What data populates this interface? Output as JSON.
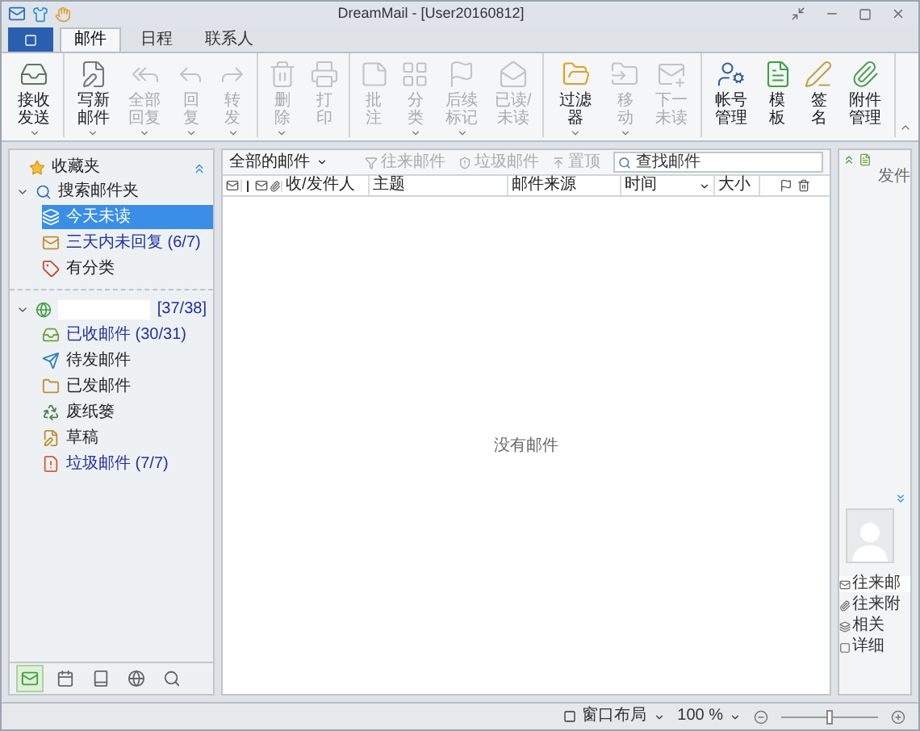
{
  "window": {
    "title": "DreamMail - [User20160812]"
  },
  "tabs": [
    {
      "label": "邮件",
      "selected": true
    },
    {
      "label": "日程",
      "selected": false
    },
    {
      "label": "联系人",
      "selected": false
    }
  ],
  "ribbon": [
    [
      {
        "label": "接收发送",
        "disabled": false,
        "dropdown": true
      }
    ],
    [
      {
        "label": "写新邮件",
        "disabled": false,
        "dropdown": true
      },
      {
        "label": "全部回复",
        "disabled": true,
        "dropdown": true
      },
      {
        "label": "回复",
        "disabled": true,
        "dropdown": true
      },
      {
        "label": "转发",
        "disabled": true,
        "dropdown": true
      }
    ],
    [
      {
        "label": "删除",
        "disabled": true,
        "dropdown": true
      },
      {
        "label": "打印",
        "disabled": true,
        "dropdown": false
      }
    ],
    [
      {
        "label": "批注",
        "disabled": true,
        "dropdown": false
      },
      {
        "label": "分类",
        "disabled": true,
        "dropdown": true
      },
      {
        "label": "后续标记",
        "disabled": true,
        "dropdown": true
      },
      {
        "label": "已读/未读",
        "disabled": true,
        "dropdown": false
      }
    ],
    [
      {
        "label": "过滤器",
        "disabled": false,
        "dropdown": true
      },
      {
        "label": "移动",
        "disabled": true,
        "dropdown": true
      },
      {
        "label": "下一未读",
        "disabled": true,
        "dropdown": false
      }
    ],
    [
      {
        "label": "帐号管理",
        "disabled": false,
        "dropdown": false
      },
      {
        "label": "模板",
        "disabled": false,
        "dropdown": false
      },
      {
        "label": "签名",
        "disabled": false,
        "dropdown": false
      },
      {
        "label": "附件管理",
        "disabled": false,
        "dropdown": false
      }
    ]
  ],
  "sidebar": {
    "favorites": {
      "label": "收藏夹",
      "expanded": true,
      "children": [
        {
          "label": "搜索邮件夹",
          "expanded": true,
          "children": [
            {
              "label": "今天未读",
              "selected": true,
              "unread": false
            },
            {
              "label": "三天内未回复 (6/7)",
              "selected": false,
              "unread": true
            },
            {
              "label": "有分类",
              "selected": false,
              "unread": false
            }
          ]
        }
      ]
    },
    "account": {
      "count": "[37/38]",
      "expanded": true,
      "children": [
        {
          "label": "已收邮件 (30/31)",
          "selected": false,
          "unread": true
        },
        {
          "label": "待发邮件",
          "selected": false,
          "unread": false
        },
        {
          "label": "已发邮件",
          "selected": false,
          "unread": false
        },
        {
          "label": "废纸篓",
          "selected": false,
          "unread": false
        },
        {
          "label": "草稿",
          "selected": false,
          "unread": false
        },
        {
          "label": "垃圾邮件 (7/7)",
          "selected": false,
          "unread": true
        }
      ]
    },
    "bottom_tabs": [
      {
        "selected": true
      },
      {
        "selected": false
      },
      {
        "selected": false
      },
      {
        "selected": false
      },
      {
        "selected": false
      }
    ]
  },
  "mail_list": {
    "view": "全部的邮件",
    "actions": [
      {
        "label": "往来邮件",
        "disabled": true
      },
      {
        "label": "垃圾邮件",
        "disabled": true
      },
      {
        "label": "置顶",
        "disabled": true
      }
    ],
    "search": {
      "placeholder": "查找邮件"
    },
    "columns": [
      "收/发件人",
      "主题",
      "邮件来源",
      "时间",
      "大小"
    ],
    "empty": "没有邮件"
  },
  "right_panel": {
    "top": "发件",
    "items": [
      {
        "label": "往来邮",
        "selected": true
      },
      {
        "label": "往来附",
        "selected": false
      },
      {
        "label": "相关",
        "selected": false
      },
      {
        "label": "详细",
        "selected": false
      }
    ]
  },
  "status_bar": {
    "layout": "窗口布局",
    "zoom": "100 %",
    "zoom_slider": {
      "level": 0.5
    }
  }
}
